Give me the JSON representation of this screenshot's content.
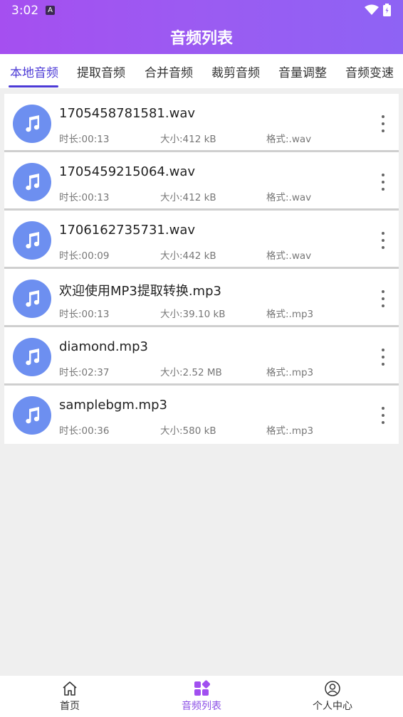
{
  "status_bar": {
    "time": "3:02",
    "notification_icon": "a-icon"
  },
  "header": {
    "title": "音频列表"
  },
  "tabs": [
    {
      "label": "本地音频",
      "active": true
    },
    {
      "label": "提取音频"
    },
    {
      "label": "合并音频"
    },
    {
      "label": "裁剪音频"
    },
    {
      "label": "音量调整"
    },
    {
      "label": "音频变速"
    }
  ],
  "files": [
    {
      "name": "1705458781581.wav",
      "duration": "时长:00:13",
      "size": "大小:412 kB",
      "format": "格式:.wav"
    },
    {
      "name": "1705459215064.wav",
      "duration": "时长:00:13",
      "size": "大小:412 kB",
      "format": "格式:.wav"
    },
    {
      "name": "1706162735731.wav",
      "duration": "时长:00:09",
      "size": "大小:442 kB",
      "format": "格式:.wav"
    },
    {
      "name": "欢迎使用MP3提取转换.mp3",
      "duration": "时长:00:13",
      "size": "大小:39.10 kB",
      "format": "格式:.mp3"
    },
    {
      "name": "diamond.mp3",
      "duration": "时长:02:37",
      "size": "大小:2.52 MB",
      "format": "格式:.mp3"
    },
    {
      "name": "samplebgm.mp3",
      "duration": "时长:00:36",
      "size": "大小:580 kB",
      "format": "格式:.mp3"
    }
  ],
  "bottom_nav": [
    {
      "label": "首页",
      "icon": "home-icon"
    },
    {
      "label": "音频列表",
      "icon": "grid-icon",
      "active": true
    },
    {
      "label": "个人中心",
      "icon": "person-icon"
    }
  ],
  "colors": {
    "header_start": "#a54ff0",
    "header_end": "#8e63f4",
    "tab_active": "#4c3ad6",
    "avatar": "#6d8ff0",
    "nav_active": "#8b4fe6"
  }
}
